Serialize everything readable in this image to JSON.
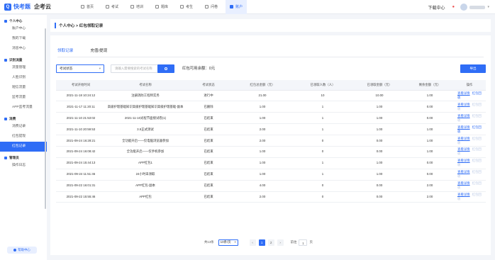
{
  "logo": {
    "name": "快考题",
    "sub": "企考云"
  },
  "nav": [
    {
      "label": "首页",
      "active": false
    },
    {
      "label": "考试",
      "active": false
    },
    {
      "label": "培训",
      "active": false
    },
    {
      "label": "题库",
      "active": false
    },
    {
      "label": "考生",
      "active": false
    },
    {
      "label": "问卷",
      "active": false
    },
    {
      "label": "账户",
      "active": true
    }
  ],
  "topright": {
    "download": "下载中心"
  },
  "sidebar": {
    "groups": [
      {
        "title": "个人中心",
        "items": [
          {
            "label": "账户中心",
            "active": false
          },
          {
            "label": "我的下载",
            "active": false
          },
          {
            "label": "消息中心",
            "active": false
          }
        ]
      },
      {
        "title": "识别流量",
        "items": [
          {
            "label": "流量管理",
            "active": false
          },
          {
            "label": "人脸识别",
            "active": false
          },
          {
            "label": "短信流量",
            "active": false
          },
          {
            "label": "监考流量",
            "active": false
          },
          {
            "label": "APP监考流量",
            "active": false
          }
        ]
      },
      {
        "title": "消费",
        "items": [
          {
            "label": "消费记录",
            "active": false
          },
          {
            "label": "红包提现",
            "active": false
          },
          {
            "label": "红包记录",
            "active": true
          }
        ]
      },
      {
        "title": "管理员",
        "items": [
          {
            "label": "操作日志",
            "active": false
          }
        ]
      }
    ],
    "help": "帮助中心"
  },
  "breadcrumb": "个人中心 > 红包领取记录",
  "tabs": [
    {
      "label": "领取记录",
      "active": true
    },
    {
      "label": "充值/提现",
      "active": false
    }
  ],
  "filter": {
    "status_placeholder": "考试状态",
    "search_placeholder": "请输入需要搜索的考试名称"
  },
  "balance": "红包可用余额：0元",
  "export_label": "导出",
  "table": {
    "headers": [
      "考试开始时间",
      "考试名称",
      "考试状态",
      "红包总金额（元）",
      "已领取人数（人）",
      "已领取金额（元）",
      "剩余金额（元）",
      "操作"
    ],
    "rows": [
      [
        "2021-11-18 10:24:12",
        "注册消防工程师实务",
        "进行中",
        "21.00",
        "10",
        "10.00",
        "1.00",
        true
      ],
      [
        "2021-11-17 11:20:11",
        "高级护理基础知识高级护理基础知识高级护理基础-副本",
        "已删除",
        "1.00",
        "1",
        "1.00",
        "0.00",
        false
      ],
      [
        "2021-11-10 21:53:02",
        "2021-11-10光程节面接试卷(1)",
        "已结束",
        "1.00",
        "1",
        "1.00",
        "0.00",
        false
      ],
      [
        "2021-11-10 20:59:53",
        "3.9正式测试",
        "已结束",
        "2.00",
        "1",
        "1.00",
        "1.00",
        true
      ],
      [
        "2021-09-24 16:28:21",
        "全功能开启——仅电脑浏览器参加",
        "已结束",
        "2.00",
        "0",
        "0.00",
        "1.00",
        false
      ],
      [
        "2021-09-24 16:08:42",
        "全功能开启——仅手机参加",
        "已结束",
        "1.00",
        "0",
        "0.00",
        "1.00",
        false
      ],
      [
        "2021-09-24 15:44:13",
        "APP红包1",
        "已结束",
        "1.00",
        "1",
        "1.00",
        "0.00",
        false
      ],
      [
        "2021-09-24 11:51:46",
        "24小时未领取",
        "已结束",
        "1.00",
        "1",
        "1.00",
        "0.00",
        false
      ],
      [
        "2021-09-22 16:01:31",
        "APP红包-副本",
        "已结束",
        "4.00",
        "0",
        "0.00",
        "2.00",
        false
      ],
      [
        "2021-09-22 15:55:46",
        "APP红包",
        "已结束",
        "2.00",
        "0",
        "0.00",
        "2.00",
        false
      ]
    ],
    "op_detail": "查看详情",
    "op_retrieve": "红包回收"
  },
  "pager": {
    "total": "共13条",
    "size": "10条/页",
    "pages": [
      "1",
      "2"
    ],
    "current": "1",
    "jump_prefix": "前往",
    "jump_value": "1",
    "jump_suffix": "页"
  },
  "colors": {
    "accent": "#2f6df6",
    "background": "#f3f5f9"
  }
}
